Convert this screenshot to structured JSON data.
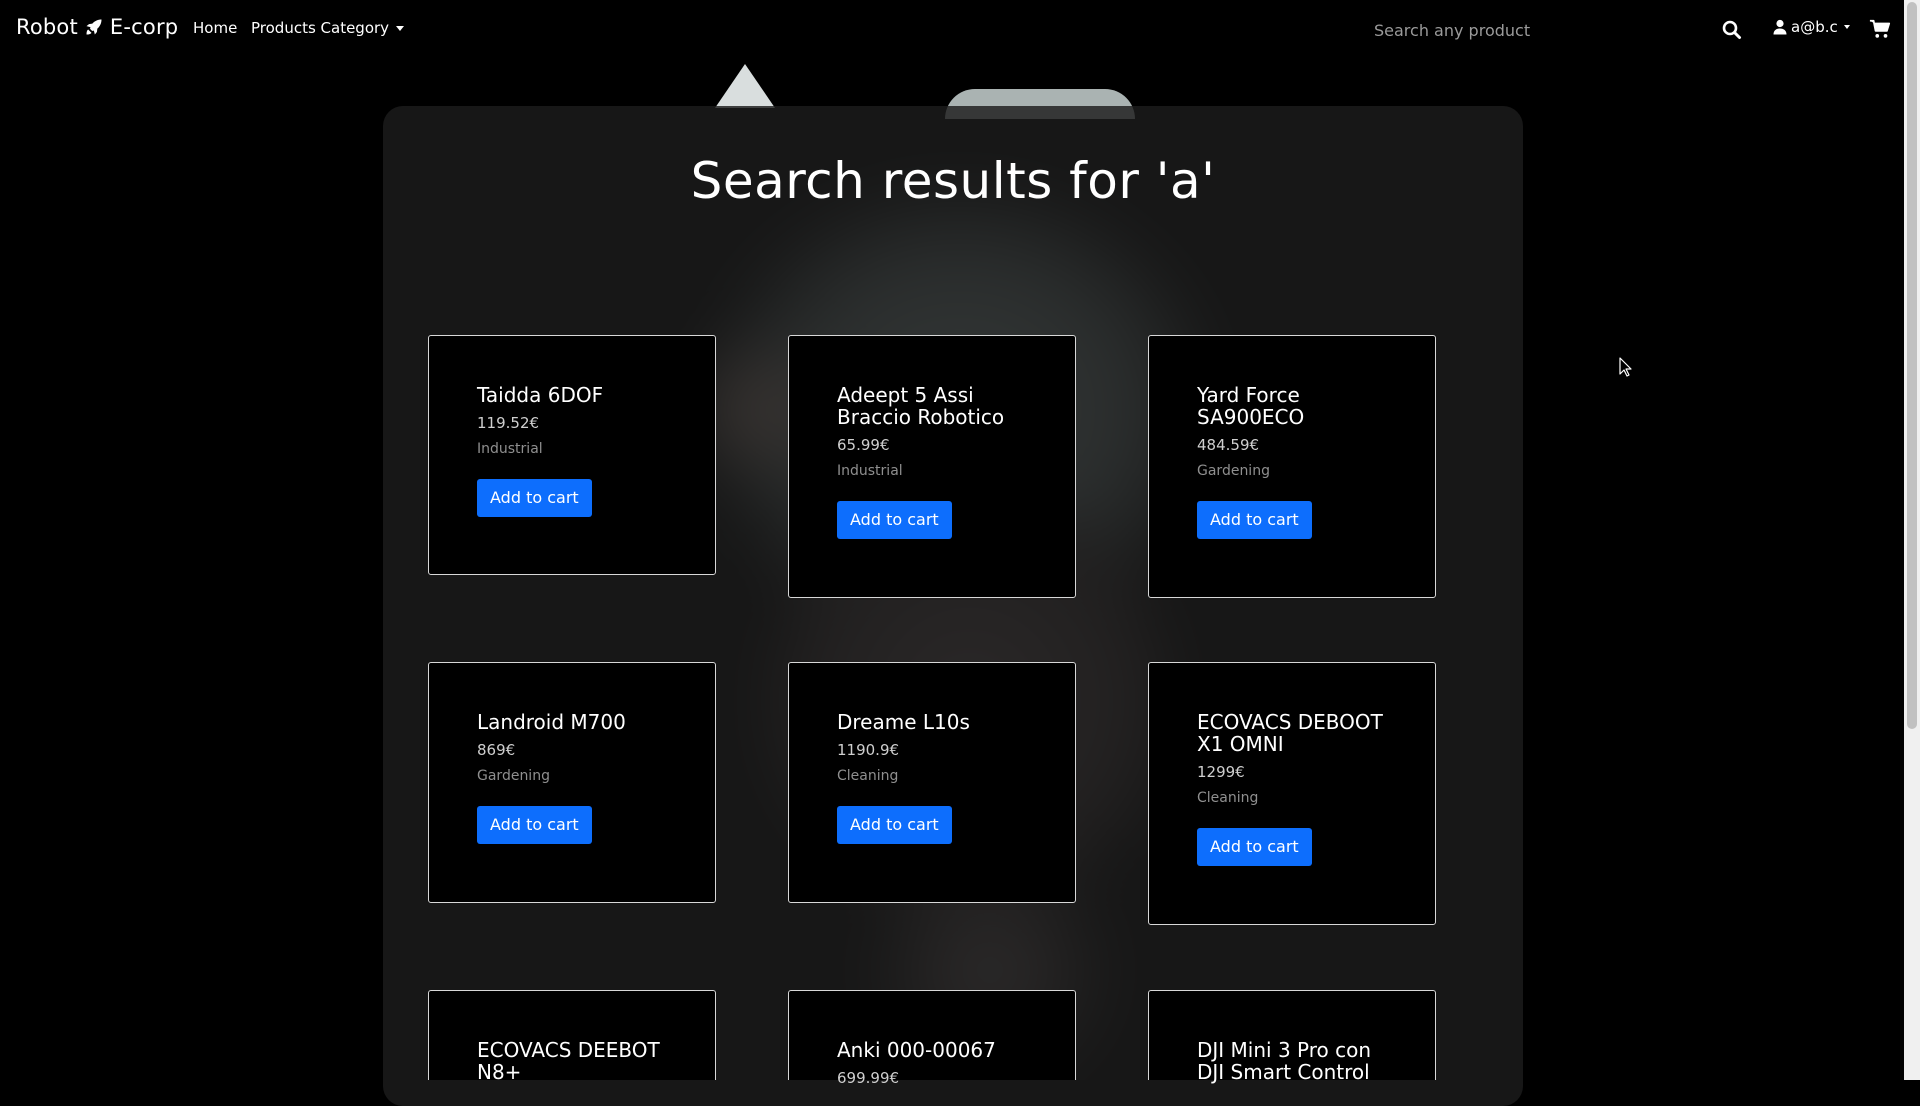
{
  "navbar": {
    "brand_left": "Robot",
    "brand_right": "E-corp",
    "home_label": "Home",
    "category_label": "Products Category",
    "search_placeholder": "Search any product",
    "user_label": "a@b.c"
  },
  "page": {
    "title": "Search results for 'a'"
  },
  "products": [
    {
      "name": "Taidda 6DOF",
      "price": "119.52€",
      "category": "Industrial",
      "button": "Add to cart"
    },
    {
      "name": "Adeept 5 Assi Braccio Robotico",
      "price": "65.99€",
      "category": "Industrial",
      "button": "Add to cart"
    },
    {
      "name": "Yard Force SA900ECO",
      "price": "484.59€",
      "category": "Gardening",
      "button": "Add to cart"
    },
    {
      "name": "Landroid M700",
      "price": "869€",
      "category": "Gardening",
      "button": "Add to cart"
    },
    {
      "name": "Dreame L10s",
      "price": "1190.9€",
      "category": "Cleaning",
      "button": "Add to cart"
    },
    {
      "name": "ECOVACS DEBOOT X1 OMNI",
      "price": "1299€",
      "category": "Cleaning",
      "button": "Add to cart"
    },
    {
      "name": "ECOVACS DEEBOT N8+",
      "price": "",
      "category": "",
      "button": ""
    },
    {
      "name": "Anki 000-00067",
      "price": "699.99€",
      "category": "",
      "button": ""
    },
    {
      "name": "DJI Mini 3 Pro con DJI Smart Control",
      "price": "",
      "category": "",
      "button": ""
    }
  ],
  "colors": {
    "accent": "#0d6efd",
    "background": "#000000",
    "panel": "#1c1c1c"
  },
  "icons": {
    "brand": "rocket-icon",
    "search": "search-icon",
    "user": "user-icon",
    "cart": "cart-icon"
  }
}
